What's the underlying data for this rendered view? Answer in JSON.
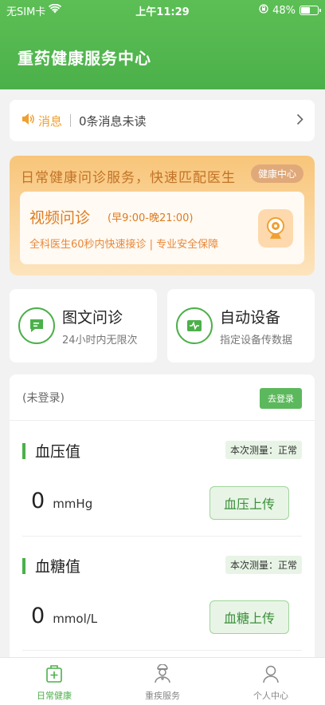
{
  "status_bar": {
    "carrier": "无SIM卡",
    "time": "上午11:29",
    "battery": "48%",
    "battery_level": 0.48
  },
  "header": {
    "title": "重药健康服务中心"
  },
  "message": {
    "label": "消息",
    "text": "0条消息未读"
  },
  "banner": {
    "title": "日常健康问诊服务，快速匹配医生",
    "tag": "健康中心",
    "video_title": "视频问诊",
    "video_time": "(早9:00-晚21:00)",
    "video_sub": "全科医生60秒内快速接诊 | 专业安全保障"
  },
  "services": [
    {
      "title": "图文问诊",
      "sub": "24小时内无限次"
    },
    {
      "title": "自动设备",
      "sub": "指定设备传数据"
    }
  ],
  "panel": {
    "not_logged": "(未登录)",
    "login_button": "去登录",
    "blood_pressure": {
      "title": "血压值",
      "status": "本次测量：正常",
      "value": "0",
      "unit": "mmHg",
      "button": "血压上传"
    },
    "blood_sugar": {
      "title": "血糖值",
      "status": "本次测量：正常",
      "value": "0",
      "unit": "mmol/L",
      "button": "血糖上传"
    }
  },
  "tabbar": [
    {
      "label": "日常健康",
      "active": true
    },
    {
      "label": "重疾服务",
      "active": false
    },
    {
      "label": "个人中心",
      "active": false
    }
  ],
  "colors": {
    "primary": "#4cb04a",
    "accent": "#e07b1f"
  }
}
